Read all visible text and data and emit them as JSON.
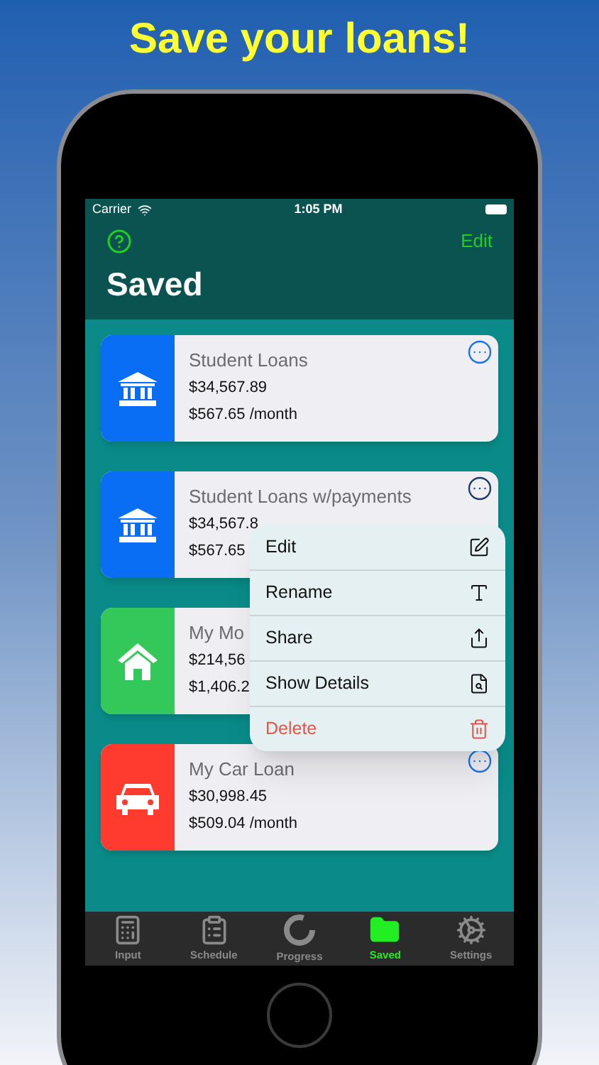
{
  "headline": "Save your loans!",
  "status_bar": {
    "carrier": "Carrier",
    "time": "1:05 PM"
  },
  "nav": {
    "edit": "Edit",
    "title": "Saved"
  },
  "loans": [
    {
      "kind": "bank",
      "color": "#0a6ef5",
      "name": "Student Loans",
      "amount": "$34,567.89",
      "payment": "$567.65 /month"
    },
    {
      "kind": "bank",
      "color": "#0a6ef5",
      "name": "Student Loans w/payments",
      "amount": "$34,567.8",
      "payment": "$567.65",
      "context_menu": [
        {
          "kind": "edit",
          "label": "Edit",
          "destructive": false
        },
        {
          "kind": "rename",
          "label": "Rename",
          "destructive": false
        },
        {
          "kind": "share",
          "label": "Share",
          "destructive": false
        },
        {
          "kind": "details",
          "label": "Show Details",
          "destructive": false
        },
        {
          "kind": "delete",
          "label": "Delete",
          "destructive": true
        }
      ]
    },
    {
      "kind": "house",
      "color": "#34c759",
      "name": "My Mo",
      "amount": "$214,56",
      "payment": "$1,406.2"
    },
    {
      "kind": "car",
      "color": "#ff3b30",
      "name": "My Car Loan",
      "amount": "$30,998.45",
      "payment": "$509.04 /month"
    }
  ],
  "tabs": [
    {
      "kind": "input",
      "label": "Input",
      "selected": false
    },
    {
      "kind": "schedule",
      "label": "Schedule",
      "selected": false
    },
    {
      "kind": "progress",
      "label": "Progress",
      "selected": false
    },
    {
      "kind": "saved",
      "label": "Saved",
      "selected": true
    },
    {
      "kind": "settings",
      "label": "Settings",
      "selected": false
    }
  ]
}
